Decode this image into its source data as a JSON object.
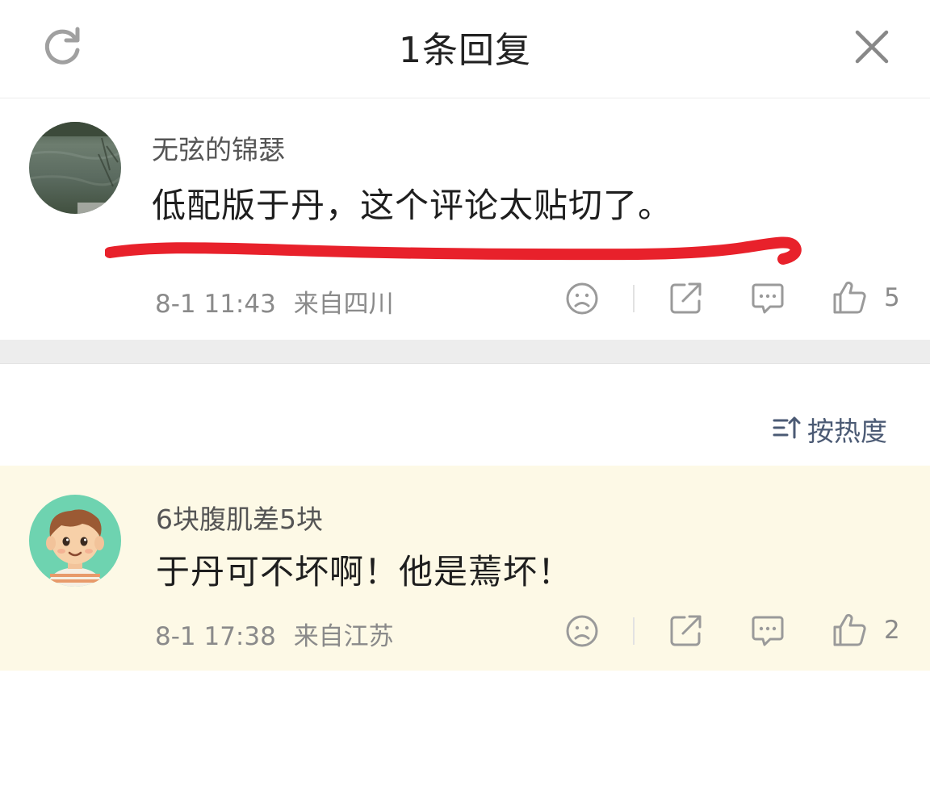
{
  "header": {
    "title": "1条回复",
    "refresh_icon": "refresh-icon",
    "close_icon": "close-icon"
  },
  "main_comment": {
    "username": "无弦的锦瑟",
    "content": "低配版于丹，这个评论太贴切了。",
    "time": "8-1 11:43",
    "location": "来自四川",
    "likes": "5",
    "highlight_color": "#e8212b"
  },
  "sort": {
    "label": "按热度",
    "icon": "sort-icon"
  },
  "reply": {
    "username": "6块腹肌差5块",
    "content": "于丹可不坏啊！他是蔫坏！",
    "time": "8-1 17:38",
    "location": "来自江苏",
    "likes": "2",
    "background": "#fdf9e6"
  },
  "colors": {
    "icon_gray": "#9a9a9a",
    "meta_gray": "#8a8a8a",
    "sort_blue": "#4b5a74"
  }
}
